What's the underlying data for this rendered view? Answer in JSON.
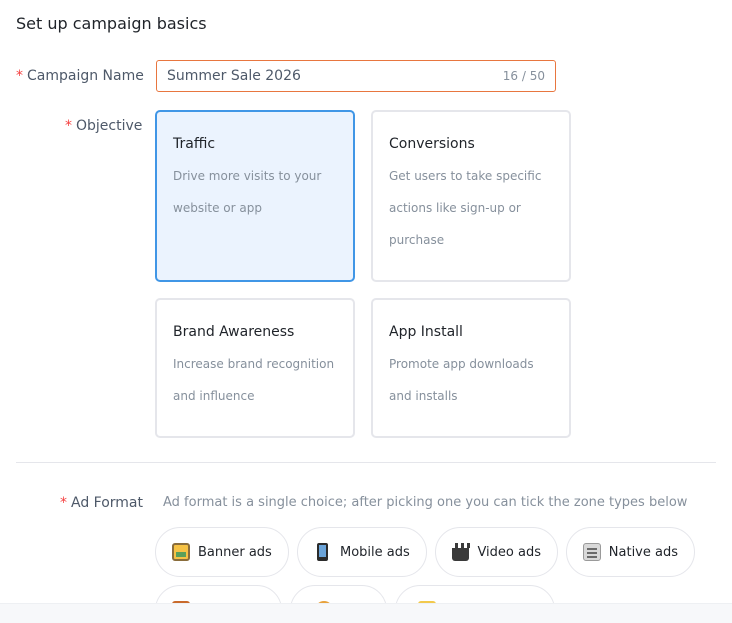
{
  "page": {
    "title": "Set up campaign basics"
  },
  "campaign_name": {
    "required_mark": "*",
    "label": "Campaign Name",
    "value": "Summer Sale 2026",
    "counter": "16 / 50"
  },
  "objective": {
    "required_mark": "*",
    "label": "Objective",
    "selected": "Traffic",
    "cards": [
      {
        "title": "Traffic",
        "desc_lines": [
          "Drive more visits to your",
          "website or app"
        ]
      },
      {
        "title": "Conversions",
        "desc_lines": [
          "Get users to take specific",
          "actions like sign-up or",
          "purchase"
        ]
      },
      {
        "title": "Brand Awareness",
        "desc_lines": [
          "Increase brand recognition",
          "and influence"
        ]
      },
      {
        "title": "App Install",
        "desc_lines": [
          "Promote app downloads",
          "and installs"
        ]
      }
    ]
  },
  "ad_format": {
    "required_mark": "*",
    "label": "Ad Format",
    "hint": "Ad format is a single choice; after picking one you can tick the zone types below",
    "options": [
      {
        "label": "Banner ads",
        "icon": "image-frame-icon"
      },
      {
        "label": "Mobile ads",
        "icon": "mobile-phone-icon"
      },
      {
        "label": "Video ads",
        "icon": "clapperboard-icon"
      },
      {
        "label": "Native ads",
        "icon": "newspaper-icon"
      }
    ]
  },
  "colors": {
    "accent": "#4096e6",
    "selected_bg": "#ebf3fe",
    "required": "#f53f3f",
    "input_border": "#e8763f"
  }
}
